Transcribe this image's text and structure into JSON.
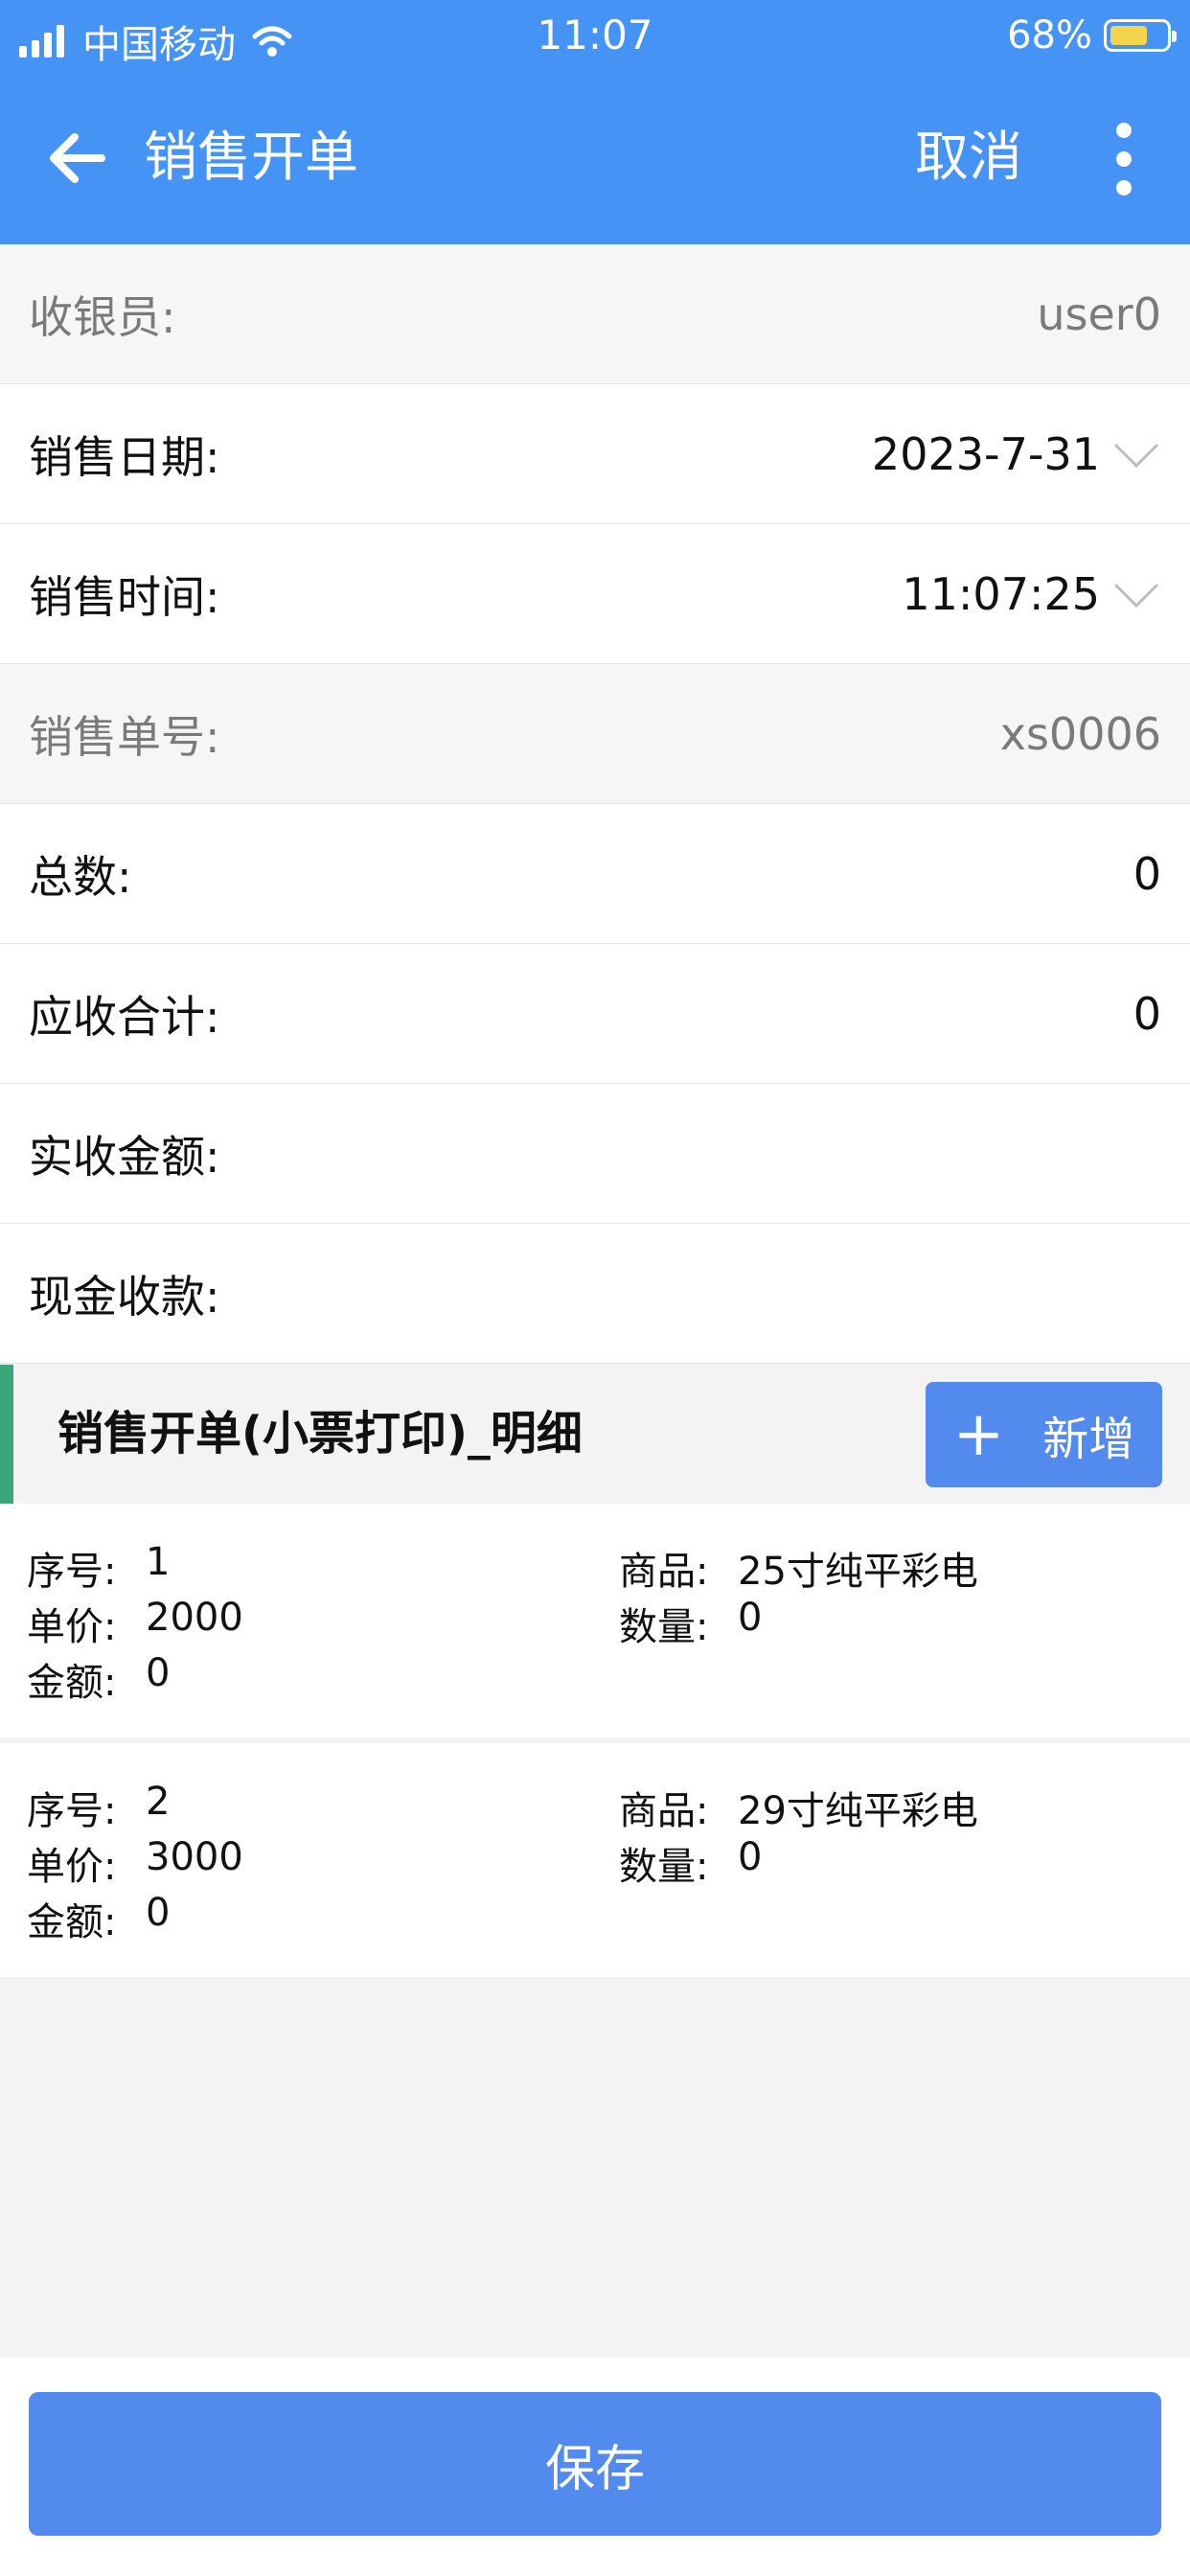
{
  "status_bar": {
    "carrier": "中国移动",
    "time": "11:07",
    "battery": "68%",
    "battery_level": 0.68,
    "icons": [
      "signal-icon",
      "wifi-icon",
      "battery-icon"
    ]
  },
  "nav": {
    "back_icon": "arrow-left-icon",
    "title": "销售开单",
    "cancel": "取消",
    "more_icon": "more-vertical-icon"
  },
  "form": {
    "cashier": {
      "label": "收银员:",
      "value": "user0"
    },
    "sale_date": {
      "label": "销售日期:",
      "value": "2023-7-31"
    },
    "sale_time": {
      "label": "销售时间:",
      "value": "11:07:25"
    },
    "order_no": {
      "label": "销售单号:",
      "value": "xs0006"
    },
    "total_count": {
      "label": "总数:",
      "value": "0"
    },
    "receivable": {
      "label": "应收合计:",
      "value": "0"
    },
    "received": {
      "label": "实收金额:",
      "value": ""
    },
    "cash": {
      "label": "现金收款:",
      "value": ""
    }
  },
  "detail": {
    "title": "销售开单(小票打印)_明细",
    "add_label": "新增",
    "add_icon": "plus-icon",
    "keys": {
      "seq": "序号:",
      "product": "商品:",
      "price": "单价:",
      "qty": "数量:",
      "amount": "金额:"
    },
    "items": [
      {
        "seq": "1",
        "product": "25寸纯平彩电",
        "price": "2000",
        "qty": "0",
        "amount": "0"
      },
      {
        "seq": "2",
        "product": "29寸纯平彩电",
        "price": "3000",
        "qty": "0",
        "amount": "0"
      }
    ]
  },
  "footer": {
    "save": "保存"
  },
  "colors": {
    "header_bg": "#4593f5",
    "button_bg": "#528aee",
    "section_accent": "#3aa57a",
    "battery_fill": "#f6d44a"
  }
}
